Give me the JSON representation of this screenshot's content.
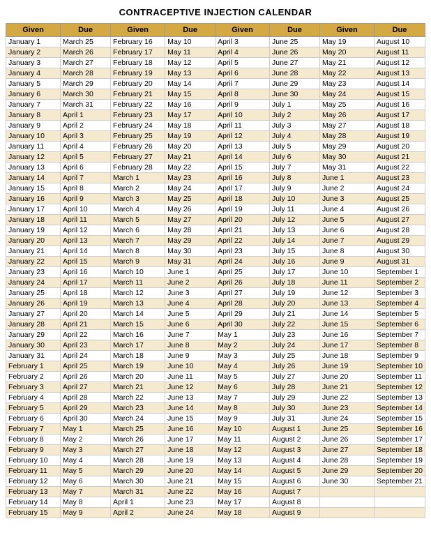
{
  "title": "CONTRACEPTIVE INJECTION CALENDAR",
  "headers": [
    "Given",
    "Due",
    "Given",
    "Due",
    "Given",
    "Due",
    "Given",
    "Due"
  ],
  "rows": [
    [
      "January 1",
      "March 25",
      "February 16",
      "May 10",
      "April 3",
      "June 25",
      "May 19",
      "August 10"
    ],
    [
      "January 2",
      "March 26",
      "February 17",
      "May 11",
      "April 4",
      "June 26",
      "May 20",
      "August 11"
    ],
    [
      "January 3",
      "March 27",
      "February 18",
      "May 12",
      "April 5",
      "June 27",
      "May 21",
      "August 12"
    ],
    [
      "January 4",
      "March 28",
      "February 19",
      "May 13",
      "April 6",
      "June 28",
      "May 22",
      "August 13"
    ],
    [
      "January 5",
      "March 29",
      "February 20",
      "May 14",
      "April 7",
      "June 29",
      "May 23",
      "August 14"
    ],
    [
      "January 6",
      "March 30",
      "February 21",
      "May 15",
      "April 8",
      "June 30",
      "May 24",
      "August 15"
    ],
    [
      "January 7",
      "March 31",
      "February 22",
      "May 16",
      "April 9",
      "July 1",
      "May 25",
      "August 16"
    ],
    [
      "January 8",
      "April 1",
      "February 23",
      "May 17",
      "April 10",
      "July 2",
      "May 26",
      "August 17"
    ],
    [
      "January 9",
      "April 2",
      "February 24",
      "May 18",
      "April 11",
      "July 3",
      "May 27",
      "August 18"
    ],
    [
      "January 10",
      "April 3",
      "February 25",
      "May 19",
      "April 12",
      "July 4",
      "May 28",
      "August 19"
    ],
    [
      "January 11",
      "April 4",
      "February 26",
      "May 20",
      "April 13",
      "July 5",
      "May 29",
      "August 20"
    ],
    [
      "January 12",
      "April 5",
      "February 27",
      "May 21",
      "April 14",
      "July 6",
      "May 30",
      "August 21"
    ],
    [
      "January 13",
      "April 6",
      "February 28",
      "May 22",
      "April 15",
      "July 7",
      "May 31",
      "August 22"
    ],
    [
      "January 14",
      "April 7",
      "March 1",
      "May 23",
      "April 16",
      "July 8",
      "June 1",
      "August 23"
    ],
    [
      "January 15",
      "April 8",
      "March 2",
      "May 24",
      "April 17",
      "July 9",
      "June 2",
      "August 24"
    ],
    [
      "January 16",
      "April 9",
      "March 3",
      "May 25",
      "April 18",
      "July 10",
      "June 3",
      "August 25"
    ],
    [
      "January 17",
      "April 10",
      "March 4",
      "May 26",
      "April 19",
      "July 11",
      "June 4",
      "August 26"
    ],
    [
      "January 18",
      "April 11",
      "March 5",
      "May 27",
      "April 20",
      "July 12",
      "June 5",
      "August 27"
    ],
    [
      "January 19",
      "April 12",
      "March 6",
      "May 28",
      "April 21",
      "July 13",
      "June 6",
      "August 28"
    ],
    [
      "January 20",
      "April 13",
      "March 7",
      "May 29",
      "April 22",
      "July 14",
      "June 7",
      "August 29"
    ],
    [
      "January 21",
      "April 14",
      "March 8",
      "May 30",
      "April 23",
      "July 15",
      "June 8",
      "August 30"
    ],
    [
      "January 22",
      "April 15",
      "March 9",
      "May 31",
      "April 24",
      "July 16",
      "June 9",
      "August 31"
    ],
    [
      "January 23",
      "April 16",
      "March 10",
      "June 1",
      "April 25",
      "July 17",
      "June 10",
      "September 1"
    ],
    [
      "January 24",
      "April 17",
      "March 11",
      "June 2",
      "April 26",
      "July 18",
      "June 11",
      "September 2"
    ],
    [
      "January 25",
      "April 18",
      "March 12",
      "June 3",
      "April 27",
      "July 19",
      "June 12",
      "September 3"
    ],
    [
      "January 26",
      "April 19",
      "March 13",
      "June 4",
      "April 28",
      "July 20",
      "June 13",
      "September 4"
    ],
    [
      "January 27",
      "April 20",
      "March 14",
      "June 5",
      "April 29",
      "July 21",
      "June 14",
      "September 5"
    ],
    [
      "January 28",
      "April 21",
      "March 15",
      "June 6",
      "April 30",
      "July 22",
      "June 15",
      "September 6"
    ],
    [
      "January 29",
      "April 22",
      "March 16",
      "June 7",
      "May 1",
      "July 23",
      "June 16",
      "September 7"
    ],
    [
      "January 30",
      "April 23",
      "March 17",
      "June 8",
      "May 2",
      "July 24",
      "June 17",
      "September 8"
    ],
    [
      "January 31",
      "April 24",
      "March 18",
      "June 9",
      "May 3",
      "July 25",
      "June 18",
      "September 9"
    ],
    [
      "February 1",
      "April 25",
      "March 19",
      "June 10",
      "May 4",
      "July 26",
      "June 19",
      "September 10"
    ],
    [
      "February 2",
      "April 26",
      "March 20",
      "June 11",
      "May 5",
      "July 27",
      "June 20",
      "September 11"
    ],
    [
      "February 3",
      "April 27",
      "March 21",
      "June 12",
      "May 6",
      "July 28",
      "June 21",
      "September 12"
    ],
    [
      "February 4",
      "April 28",
      "March 22",
      "June 13",
      "May 7",
      "July 29",
      "June 22",
      "September 13"
    ],
    [
      "February 5",
      "April 29",
      "March 23",
      "June 14",
      "May 8",
      "July 30",
      "June 23",
      "September 14"
    ],
    [
      "February 6",
      "April 30",
      "March 24",
      "June 15",
      "May 9",
      "July 31",
      "June 24",
      "September 15"
    ],
    [
      "February 7",
      "May 1",
      "March 25",
      "June 16",
      "May 10",
      "August 1",
      "June 25",
      "September 16"
    ],
    [
      "February 8",
      "May 2",
      "March 26",
      "June 17",
      "May 11",
      "August 2",
      "June 26",
      "September 17"
    ],
    [
      "February 9",
      "May 3",
      "March 27",
      "June 18",
      "May 12",
      "August 3",
      "June 27",
      "September 18"
    ],
    [
      "February 10",
      "May 4",
      "March 28",
      "June 19",
      "May 13",
      "August 4",
      "June 28",
      "September 19"
    ],
    [
      "February 11",
      "May 5",
      "March 29",
      "June 20",
      "May 14",
      "August 5",
      "June 29",
      "September 20"
    ],
    [
      "February 12",
      "May 6",
      "March 30",
      "June 21",
      "May 15",
      "August 6",
      "June 30",
      "September 21"
    ],
    [
      "February 13",
      "May 7",
      "March 31",
      "June 22",
      "May 16",
      "August 7",
      "",
      ""
    ],
    [
      "February 14",
      "May 8",
      "April 1",
      "June 23",
      "May 17",
      "August 8",
      "",
      ""
    ],
    [
      "February 15",
      "May 9",
      "April 2",
      "June 24",
      "May 18",
      "August 9",
      "",
      ""
    ]
  ]
}
